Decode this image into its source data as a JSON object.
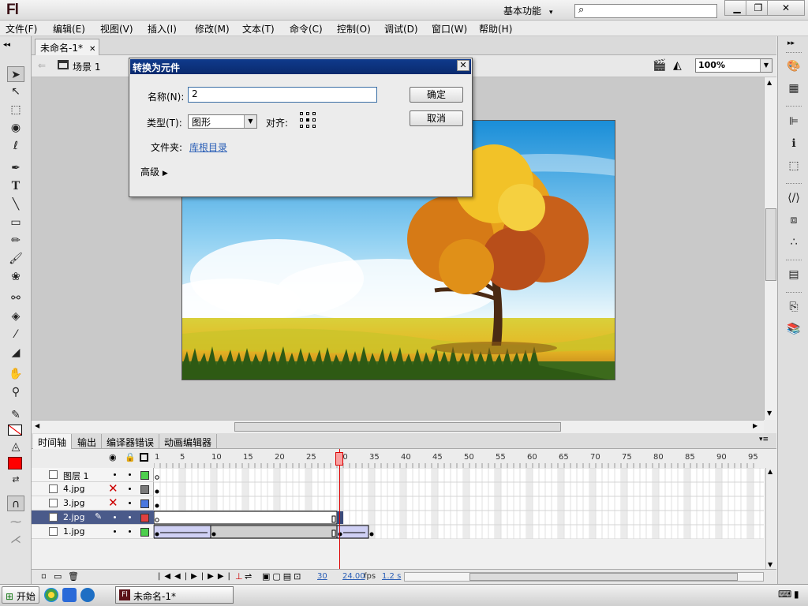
{
  "app": {
    "logo": "Fl",
    "workspace": "基本功能",
    "workspace_arrow": "▾"
  },
  "window_buttons": {
    "minimize": "▁",
    "restore": "❐",
    "close": "✕"
  },
  "menu": [
    "文件(F)",
    "编辑(E)",
    "视图(V)",
    "插入(I)",
    "修改(M)",
    "文本(T)",
    "命令(C)",
    "控制(O)",
    "调试(D)",
    "窗口(W)",
    "帮助(H)"
  ],
  "document": {
    "tab": "未命名-1*",
    "tab_close": "✕",
    "scene": "场景 1",
    "zoom": "100%"
  },
  "dialog": {
    "title": "转换为元件",
    "close": "✕",
    "name_label": "名称(N):",
    "name_value": "2",
    "type_label": "类型(T):",
    "type_value": "图形",
    "align_label": "对齐:",
    "folder_label": "文件夹:",
    "folder_link": "库根目录",
    "advanced": "高级",
    "ok": "确定",
    "cancel": "取消"
  },
  "timeline": {
    "tabs": [
      "时间轴",
      "输出",
      "编译器错误",
      "动画编辑器"
    ],
    "frame_numbers": [
      1,
      5,
      10,
      15,
      20,
      25,
      30,
      35,
      40,
      45,
      50,
      55,
      60,
      65,
      70,
      75,
      80,
      85,
      90,
      95
    ],
    "current_frame": 30,
    "layers": [
      {
        "name": "图层 1",
        "color": "#4ccf4c",
        "hidden": false,
        "selected": false
      },
      {
        "name": "4.jpg",
        "color": "#7a7a7a",
        "hidden": true,
        "selected": false
      },
      {
        "name": "3.jpg",
        "color": "#4a78e0",
        "hidden": true,
        "selected": false
      },
      {
        "name": "2.jpg",
        "color": "#e04040",
        "hidden": false,
        "selected": true
      },
      {
        "name": "1.jpg",
        "color": "#4ccf4c",
        "hidden": false,
        "selected": false
      }
    ],
    "status": {
      "frame": "30",
      "fps": "24.00",
      "fps_unit": "fps",
      "time": "1.2 s"
    }
  },
  "taskbar": {
    "start": "开始",
    "task": "未命名-1*"
  },
  "colors": {
    "stroke": "#000000",
    "fill": "#ff0000",
    "accent": "#0a2a6e"
  }
}
